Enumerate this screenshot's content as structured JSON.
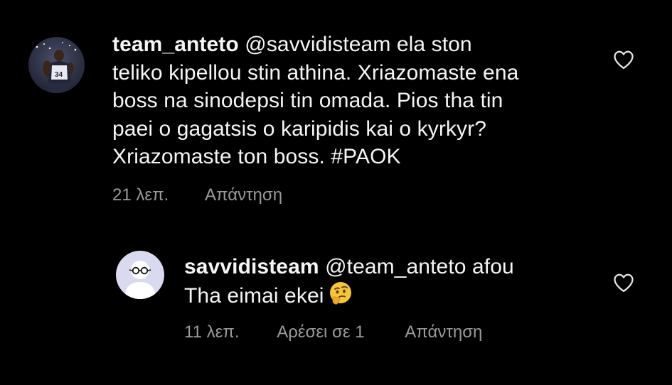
{
  "comments": [
    {
      "username": "team_anteto",
      "text_lines": [
        "@savvidisteam ela ston",
        "teliko kipellou stin athina. Xriazomaste ena",
        "boss na sinodepsi tin omada. Pios tha tin",
        "paei o gagatsis o karipidis kai o kyrkyr?",
        "Xriazomaste ton boss. #PAOK"
      ],
      "time": "21 λεπ.",
      "reply_label": "Απάντηση",
      "avatar_icon": "player-photo-avatar",
      "like_icon": "heart-outline-icon"
    },
    {
      "username": "savvidisteam",
      "text_lines": [
        "@team_anteto afou",
        "Tha eimai ekei"
      ],
      "emoji": "thinking-face-emoji",
      "time": "11 λεπ.",
      "likes_label": "Αρέσει σε 1",
      "reply_label": "Απάντηση",
      "avatar_icon": "default-user-avatar",
      "like_icon": "heart-outline-icon"
    }
  ],
  "colors": {
    "background": "#000000",
    "text": "#f5f5f5",
    "meta": "#9a9a9a",
    "avatar_placeholder_bg": "#d9d9ef",
    "avatar_placeholder_fg": "#ffffff"
  }
}
